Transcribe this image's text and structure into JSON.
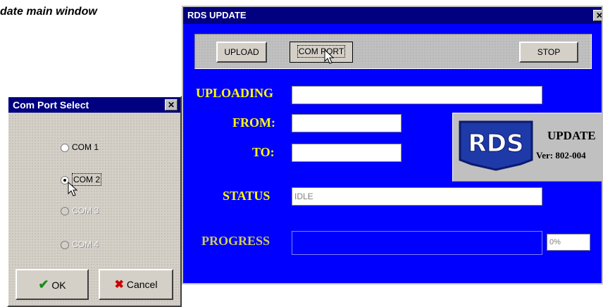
{
  "caption": "date main window",
  "main_window": {
    "title": "RDS UPDATE",
    "close_glyph": "✕",
    "toolbar": {
      "upload_label": "UPLOAD",
      "comport_label": "COM PORT",
      "stop_label": "STOP"
    },
    "labels": {
      "uploading": "UPLOADING",
      "from": "FROM:",
      "to": "TO:",
      "status": "STATUS",
      "progress": "PROGRESS"
    },
    "fields": {
      "uploading_value": "",
      "from_value": "",
      "to_value": "",
      "status_value": "IDLE",
      "progress_percent": "0%"
    },
    "logo": {
      "brand": "RDS",
      "title": "UPDATE",
      "version": "Ver: 802-004"
    }
  },
  "com_port_dialog": {
    "title": "Com Port Select",
    "close_glyph": "✕",
    "options": [
      {
        "label": "COM 1",
        "selected": false,
        "enabled": true
      },
      {
        "label": "COM 2",
        "selected": true,
        "enabled": true
      },
      {
        "label": "COM 3",
        "selected": false,
        "enabled": false
      },
      {
        "label": "COM 4",
        "selected": false,
        "enabled": false
      }
    ],
    "ok_label": "OK",
    "cancel_label": "Cancel"
  },
  "colors": {
    "window_bg": "#0000ff",
    "titlebar": "#000080",
    "label_text": "#ffff00",
    "face": "#d4d0c8"
  },
  "icons": {
    "ok": "checkmark-icon",
    "cancel": "x-icon",
    "pointer": "mouse-pointer-icon"
  }
}
